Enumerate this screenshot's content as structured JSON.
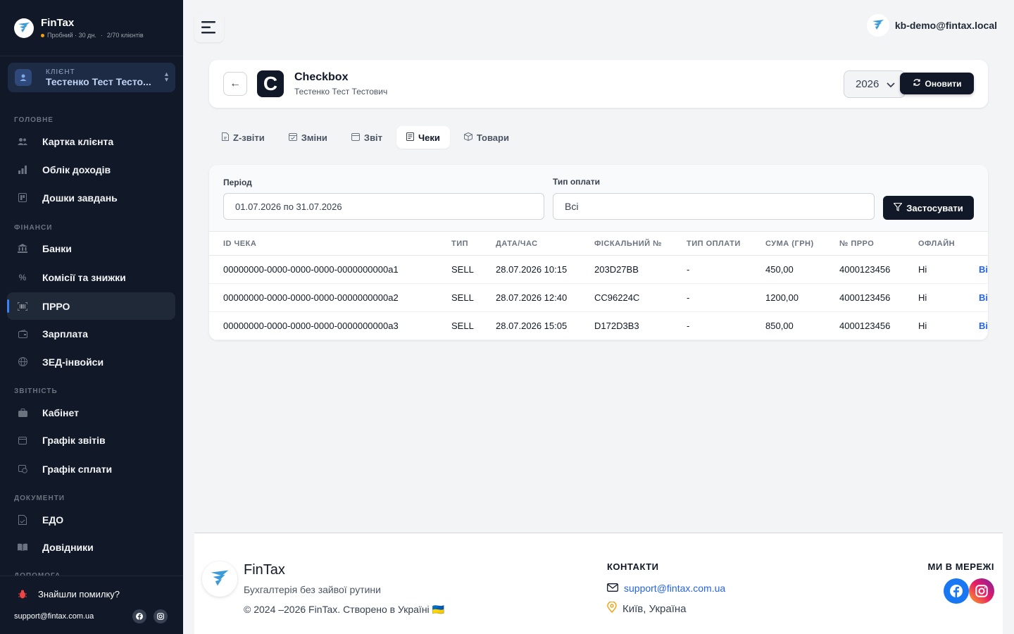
{
  "brand": {
    "name": "FinTax",
    "trial": "Пробний · 30 дн.",
    "clients": "2/70 клієнтів"
  },
  "client": {
    "label": "КЛІЄНТ",
    "name": "Тестенко Тест Тесто..."
  },
  "sidebar": {
    "sections": [
      "ГОЛОВНЕ",
      "ФІНАНСИ",
      "ЗВІТНІСТЬ",
      "ДОКУМЕНТИ",
      "ДОПОМОГА"
    ],
    "items": [
      {
        "label": "Картка клієнта",
        "icon": "users-icon"
      },
      {
        "label": "Облік доходів",
        "icon": "bar-chart-icon"
      },
      {
        "label": "Дошки завдань",
        "icon": "board-icon"
      },
      {
        "label": "Банки",
        "icon": "bank-icon"
      },
      {
        "label": "Комісії та знижки",
        "icon": "percent-icon"
      },
      {
        "label": "ПРРО",
        "icon": "barcode-icon",
        "active": true
      },
      {
        "label": "Зарплата",
        "icon": "wallet-icon"
      },
      {
        "label": "ЗЕД-інвойси",
        "icon": "globe-icon"
      },
      {
        "label": "Кабінет",
        "icon": "briefcase-icon"
      },
      {
        "label": "Графік звітів",
        "icon": "calendar-icon"
      },
      {
        "label": "Графік сплати",
        "icon": "calendar-clock-icon"
      },
      {
        "label": "ЕДО",
        "icon": "document-sign-icon"
      },
      {
        "label": "Довідники",
        "icon": "book-icon"
      }
    ],
    "bug_report": "Знайшли помилку?",
    "support_email": "support@fintax.com.ua"
  },
  "header": {
    "user_email": "kb-demo@fintax.local"
  },
  "integration": {
    "title": "Checkbox",
    "logo_letter": "C",
    "client_name": "Тестенко Тест Тестович",
    "year": "2026",
    "refresh_label": "Оновити"
  },
  "tabs": [
    {
      "label": "Z-звіти",
      "icon": "doc-icon"
    },
    {
      "label": "Зміни",
      "icon": "calendar-check-icon"
    },
    {
      "label": "Звіт",
      "icon": "calendar-icon"
    },
    {
      "label": "Чеки",
      "icon": "receipt-icon",
      "active": true
    },
    {
      "label": "Товари",
      "icon": "box-icon"
    }
  ],
  "filters": {
    "period_label": "Період",
    "period_value": "01.07.2026 по 31.07.2026",
    "payment_label": "Тип оплати",
    "payment_value": "Всі",
    "apply_label": "Застосувати"
  },
  "table": {
    "columns": [
      "ID ЧЕКА",
      "ТИП",
      "ДАТА/ЧАС",
      "ФІСКАЛЬНИЙ №",
      "ТИП ОПЛАТИ",
      "СУМА (ГРН)",
      "№ ПРРО",
      "ОФЛАЙН",
      ""
    ],
    "rows": [
      [
        "00000000-0000-0000-0000-0000000000a1",
        "SELL",
        "28.07.2026 10:15",
        "203D27BB",
        "-",
        "450,00",
        "4000123456",
        "Ні",
        "Ві"
      ],
      [
        "00000000-0000-0000-0000-0000000000a2",
        "SELL",
        "28.07.2026 12:40",
        "CC96224C",
        "-",
        "1200,00",
        "4000123456",
        "Ні",
        "Ві"
      ],
      [
        "00000000-0000-0000-0000-0000000000a3",
        "SELL",
        "28.07.2026 15:05",
        "D172D3B3",
        "-",
        "850,00",
        "4000123456",
        "Ні",
        "Ві"
      ]
    ]
  },
  "footer": {
    "name": "FinTax",
    "tagline": "Бухгалтерія без зайвої рутини",
    "copyright": "© 2024 –2026 FinTax. Створено в Україні 🇺🇦",
    "contacts_title": "КОНТАКТИ",
    "email": "support@fintax.com.ua",
    "city": "Київ, Україна",
    "social_title": "МИ В МЕРЕЖІ"
  },
  "colors": {
    "sidebar_bg": "#111827",
    "accent": "#2563eb",
    "facebook": "#1877f2"
  }
}
